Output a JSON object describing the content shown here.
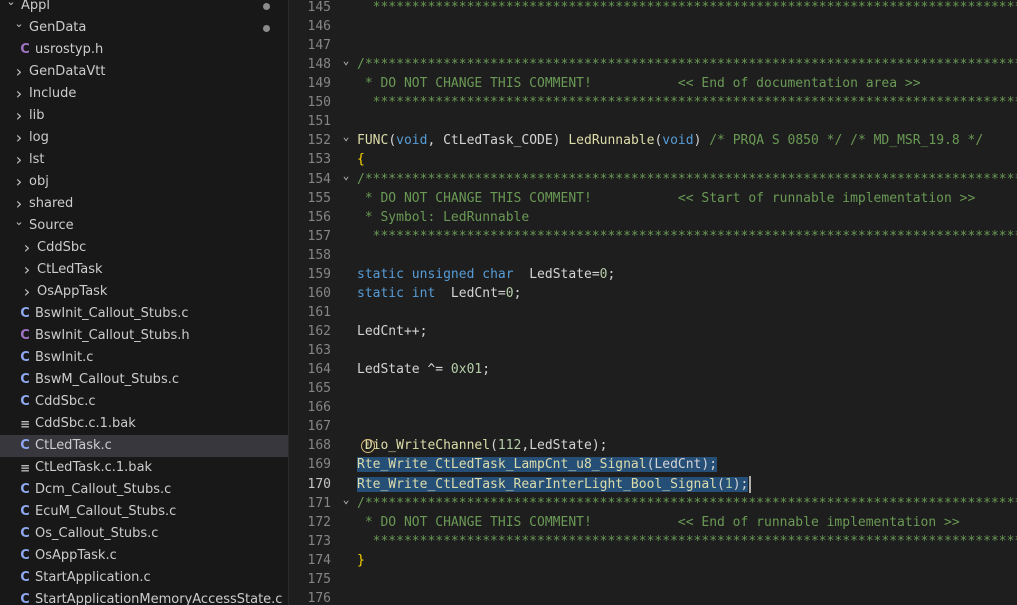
{
  "explorer": {
    "rows": [
      {
        "kind": "folder-open",
        "label": "Appl",
        "depth": 0,
        "dot": true
      },
      {
        "kind": "folder-open",
        "label": "GenData",
        "depth": 1,
        "dot": true
      },
      {
        "kind": "h",
        "label": "usrostyp.h",
        "depth": 2
      },
      {
        "kind": "folder",
        "label": "GenDataVtt",
        "depth": 1
      },
      {
        "kind": "folder",
        "label": "Include",
        "depth": 1
      },
      {
        "kind": "folder",
        "label": "lib",
        "depth": 1
      },
      {
        "kind": "folder",
        "label": "log",
        "depth": 1
      },
      {
        "kind": "folder",
        "label": "lst",
        "depth": 1
      },
      {
        "kind": "folder",
        "label": "obj",
        "depth": 1
      },
      {
        "kind": "folder",
        "label": "shared",
        "depth": 1
      },
      {
        "kind": "folder-open",
        "label": "Source",
        "depth": 1,
        "section": true
      },
      {
        "kind": "folder",
        "label": "CddSbc",
        "depth": 2
      },
      {
        "kind": "folder",
        "label": "CtLedTask",
        "depth": 2
      },
      {
        "kind": "folder",
        "label": "OsAppTask",
        "depth": 2
      },
      {
        "kind": "c",
        "label": "BswInit_Callout_Stubs.c",
        "depth": 2
      },
      {
        "kind": "h",
        "label": "BswInit_Callout_Stubs.h",
        "depth": 2
      },
      {
        "kind": "c",
        "label": "BswInit.c",
        "depth": 2
      },
      {
        "kind": "c",
        "label": "BswM_Callout_Stubs.c",
        "depth": 2
      },
      {
        "kind": "c",
        "label": "CddSbc.c",
        "depth": 2
      },
      {
        "kind": "txt",
        "label": "CddSbc.c.1.bak",
        "depth": 2
      },
      {
        "kind": "c",
        "label": "CtLedTask.c",
        "depth": 2,
        "selected": true
      },
      {
        "kind": "txt",
        "label": "CtLedTask.c.1.bak",
        "depth": 2
      },
      {
        "kind": "c",
        "label": "Dcm_Callout_Stubs.c",
        "depth": 2
      },
      {
        "kind": "c",
        "label": "EcuM_Callout_Stubs.c",
        "depth": 2
      },
      {
        "kind": "c",
        "label": "Os_Callout_Stubs.c",
        "depth": 2
      },
      {
        "kind": "c",
        "label": "OsAppTask.c",
        "depth": 2
      },
      {
        "kind": "c",
        "label": "StartApplication.c",
        "depth": 2
      },
      {
        "kind": "c",
        "label": "StartApplicationMemoryAccessState.c",
        "depth": 2
      }
    ]
  },
  "editor": {
    "active_line": "170",
    "lines": [
      {
        "n": "145",
        "fold": "",
        "text": "  ********************************************************************************************"
      },
      {
        "n": "146",
        "fold": "",
        "text": ""
      },
      {
        "n": "147",
        "fold": "",
        "text": ""
      },
      {
        "n": "148",
        "fold": "v",
        "text": "/**********************************************************************************************"
      },
      {
        "n": "149",
        "fold": "",
        "text": " * DO NOT CHANGE THIS COMMENT!           << End of documentation area >>"
      },
      {
        "n": "150",
        "fold": "",
        "text": "  ********************************************************************************************"
      },
      {
        "n": "151",
        "fold": "",
        "text": ""
      },
      {
        "n": "152",
        "fold": "v",
        "text": "FUNC(void, CtLedTask_CODE) LedRunnable(void) /* PRQA S 0850 */ /* MD_MSR_19.8 */"
      },
      {
        "n": "153",
        "fold": "",
        "text": "{"
      },
      {
        "n": "154",
        "fold": "v",
        "text": "/**********************************************************************************************"
      },
      {
        "n": "155",
        "fold": "",
        "text": " * DO NOT CHANGE THIS COMMENT!           << Start of runnable implementation >>"
      },
      {
        "n": "156",
        "fold": "",
        "text": " * Symbol: LedRunnable"
      },
      {
        "n": "157",
        "fold": "",
        "text": "  ********************************************************************************************"
      },
      {
        "n": "158",
        "fold": "",
        "text": ""
      },
      {
        "n": "159",
        "fold": "",
        "text": "static unsigned char  LedState=0;"
      },
      {
        "n": "160",
        "fold": "",
        "text": "static int  LedCnt=0;"
      },
      {
        "n": "161",
        "fold": "",
        "text": ""
      },
      {
        "n": "162",
        "fold": "",
        "text": "LedCnt++;"
      },
      {
        "n": "163",
        "fold": "",
        "text": ""
      },
      {
        "n": "164",
        "fold": "",
        "text": "LedState ^= 0x01;"
      },
      {
        "n": "165",
        "fold": "",
        "text": ""
      },
      {
        "n": "166",
        "fold": "",
        "text": ""
      },
      {
        "n": "167",
        "fold": "",
        "text": ""
      },
      {
        "n": "168",
        "fold": "",
        "text": " Dio_WriteChannel(112,LedState);"
      },
      {
        "n": "169",
        "fold": "",
        "text": "Rte_Write_CtLedTask_LampCnt_u8_Signal(LedCnt);"
      },
      {
        "n": "170",
        "fold": "",
        "text": "Rte_Write_CtLedTask_RearInterLight_Bool_Signal(1);"
      },
      {
        "n": "171",
        "fold": "v",
        "text": "/**********************************************************************************************"
      },
      {
        "n": "172",
        "fold": "",
        "text": " * DO NOT CHANGE THIS COMMENT!           << End of runnable implementation >>"
      },
      {
        "n": "173",
        "fold": "",
        "text": "  ********************************************************************************************"
      },
      {
        "n": "174",
        "fold": "",
        "text": "}"
      },
      {
        "n": "175",
        "fold": "",
        "text": ""
      },
      {
        "n": "176",
        "fold": "",
        "text": ""
      }
    ]
  },
  "colors": {
    "background": "#1e1e1e",
    "sidebar": "#181818",
    "selection": "#264f78",
    "comment": "#6a9955",
    "keyword": "#569cd6",
    "function": "#dcdcaa",
    "number": "#b5cea8"
  },
  "icons": {
    "folder_open": "chevron-down-icon",
    "folder_closed": "chevron-right-icon",
    "c_file": "c-file-icon",
    "h_file": "h-file-icon",
    "text_file": "text-file-icon",
    "lightbulb": "lightbulb-icon"
  }
}
